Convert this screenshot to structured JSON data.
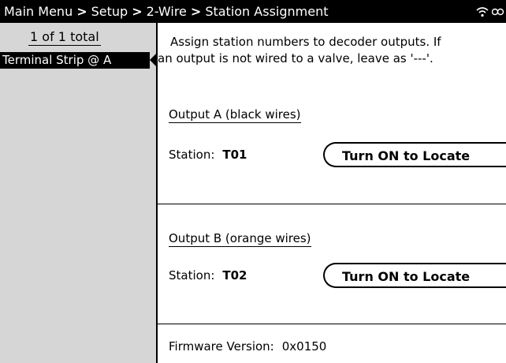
{
  "header": {
    "breadcrumb": [
      "Main Menu",
      "Setup",
      "2-Wire",
      "Station Assignment"
    ],
    "separator": ">",
    "icons": [
      "wireless-icon",
      "battery-icon"
    ]
  },
  "sidebar": {
    "position": "1",
    "of_label": "of",
    "total": "1",
    "total_label": "total",
    "items": [
      {
        "label": "Terminal Strip @ A",
        "selected": true
      }
    ]
  },
  "main": {
    "intro_line1": "Assign station numbers to decoder outputs.  If",
    "intro_line2": "an output is not wired to a valve, leave as '---'.",
    "outputs": [
      {
        "title": "Output A (black wires)",
        "station_label": "Station:",
        "station_value": "T01",
        "button_label": "Turn ON to Locate"
      },
      {
        "title": "Output B (orange wires)",
        "station_label": "Station:",
        "station_value": "T02",
        "button_label": "Turn ON to Locate"
      }
    ],
    "firmware_label": "Firmware Version:",
    "firmware_value": "0x0150"
  },
  "colors": {
    "header_bg": "#000000",
    "sidebar_bg": "#d6d6d6",
    "content_bg": "#ffffff",
    "selection_bg": "#000000"
  }
}
